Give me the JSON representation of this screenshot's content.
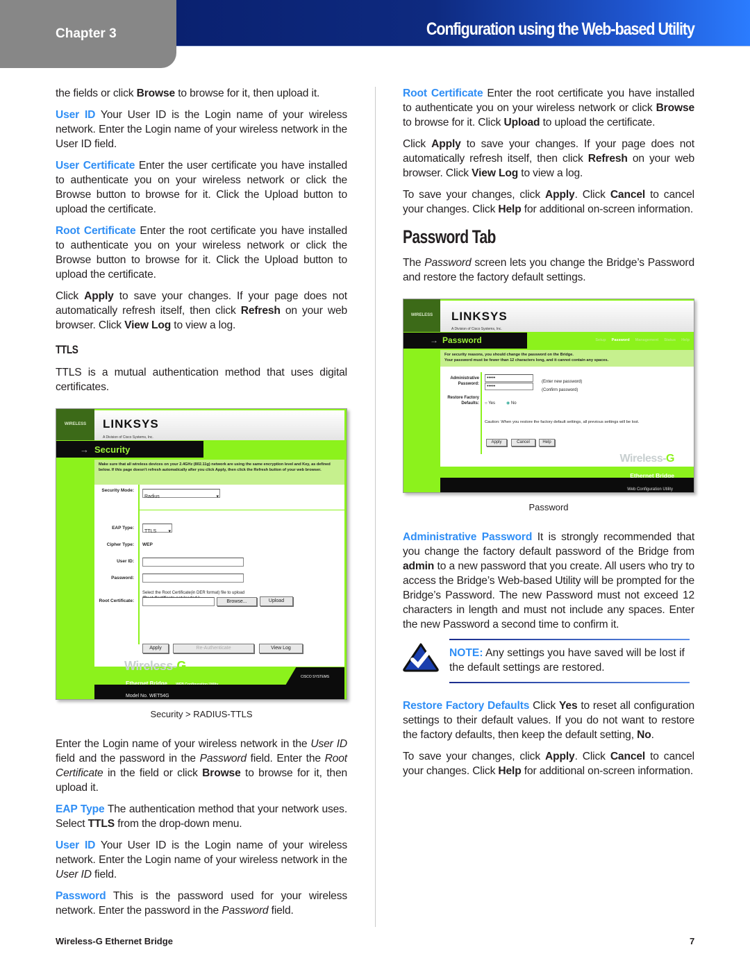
{
  "header": {
    "chapter": "Chapter 3",
    "title": "Configuration using the Web-based Utility"
  },
  "footer": {
    "product": "Wireless-G Ethernet Bridge",
    "page": "7"
  },
  "colors": {
    "accent": "#2f8ef5",
    "header_blue": "#0a2170",
    "linksys_green": "#8cf21c"
  },
  "left": {
    "top": [
      {
        "type": "p",
        "segs": [
          "the fields or click ",
          {
            "t": "Browse",
            "s": "b"
          },
          " to browse for it, then upload it."
        ]
      },
      {
        "type": "p",
        "segs": [
          {
            "t": "User ID",
            "s": "term"
          },
          "  Your User ID is the Login name of your wireless network. Enter the Login name of your wireless network in the User ID field."
        ]
      },
      {
        "type": "p",
        "segs": [
          {
            "t": "User Certificate",
            "s": "term"
          },
          "  Enter the user certificate you have installed to authenticate you on your wireless network or click the Browse button to browse for it. Click the Upload button to upload the certificate."
        ]
      },
      {
        "type": "p",
        "segs": [
          {
            "t": "Root Certificate",
            "s": "term"
          },
          "  Enter the root certificate you have installed to authenticate you on your wireless network or click the Browse button to browse for it. Click the Upload button to upload the certificate."
        ]
      },
      {
        "type": "p",
        "segs": [
          "Click ",
          {
            "t": "Apply",
            "s": "b"
          },
          " to save your changes. If your page does not automatically refresh itself, then click ",
          {
            "t": "Refresh",
            "s": "b"
          },
          " on your web browser. Click ",
          {
            "t": "View Log",
            "s": "b"
          },
          " to view a log."
        ]
      },
      {
        "type": "h3",
        "segs": [
          "TTLS"
        ]
      },
      {
        "type": "p",
        "segs": [
          "TTLS is a mutual authentication method that uses digital certificates."
        ]
      }
    ],
    "figure": {
      "caption": "Security > RADIUS-TTLS",
      "wireless": "WIRELESS",
      "logo": "LINKSYS",
      "logo_sub": "A Division of Cisco Systems, Inc.",
      "page": "Security",
      "info": "Make sure that all wireless devices on your 2.4GHz (802.11g) network are using the same encryption level and Key, as defined below. If this page doesn't refresh automatically after you click Apply, then click the Refresh button of your web browser.",
      "security_mode_label": "Security Mode:",
      "security_mode_value": "Radius",
      "eap_label": "EAP Type:",
      "eap_value": "TTLS",
      "cipher_label": "Cipher Type:",
      "cipher_value": "WEP",
      "userid_label": "User ID:",
      "password_label": "Password:",
      "root_hint": "Select the Root Certificate(in DER format) file to upload",
      "root_status": "(Root Certificate not loaded.)",
      "root_label": "Root Certificate:",
      "browse": "Browse...",
      "upload": "Upload",
      "apply": "Apply",
      "reauth": "Re-Authenticate",
      "viewlog": "View Log",
      "brand": "Wireless-",
      "brand_g": "G",
      "band": "Ethernet Bridge",
      "band_sub": "WEB Configuration Utility",
      "model": "Model No. WET54G",
      "cisco": "CISCO SYSTEMS"
    },
    "bottom": [
      {
        "type": "p",
        "segs": [
          "Enter the Login name of your wireless network in the ",
          {
            "t": "User ID",
            "s": "i"
          },
          " field and the password in the ",
          {
            "t": "Password",
            "s": "i"
          },
          " field. Enter the ",
          {
            "t": "Root Certificate",
            "s": "i"
          },
          " in the field or click ",
          {
            "t": "Browse",
            "s": "b"
          },
          " to browse for it, then upload it."
        ]
      },
      {
        "type": "p",
        "segs": [
          {
            "t": "EAP Type",
            "s": "term"
          },
          "  The authentication method that your network uses. Select ",
          {
            "t": "TTLS",
            "s": "b"
          },
          " from the drop-down menu."
        ]
      },
      {
        "type": "p",
        "segs": [
          {
            "t": "User ID",
            "s": "term"
          },
          "  Your User ID is the Login name of your wireless network. Enter the Login name of your wireless network in the ",
          {
            "t": "User ID",
            "s": "i"
          },
          " field."
        ]
      },
      {
        "type": "p",
        "segs": [
          {
            "t": "Password",
            "s": "term"
          },
          "  This is the password used for your wireless network. Enter the password in the ",
          {
            "t": "Password",
            "s": "i"
          },
          " field."
        ]
      }
    ]
  },
  "right": {
    "top": [
      {
        "type": "p",
        "segs": [
          {
            "t": "Root Certificate",
            "s": "term"
          },
          "  Enter the root certificate you have installed to authenticate you on your wireless network or click ",
          {
            "t": "Browse",
            "s": "b"
          },
          " to browse for it. Click ",
          {
            "t": "Upload",
            "s": "b"
          },
          " to upload the certificate."
        ]
      },
      {
        "type": "p",
        "segs": [
          "Click ",
          {
            "t": "Apply",
            "s": "b"
          },
          " to save your changes. If your page does not automatically refresh itself, then click ",
          {
            "t": "Refresh",
            "s": "b"
          },
          " on your web browser. Click ",
          {
            "t": "View Log",
            "s": "b"
          },
          " to view a log."
        ]
      },
      {
        "type": "p",
        "segs": [
          "To save your changes, click ",
          {
            "t": "Apply",
            "s": "b"
          },
          ". Click ",
          {
            "t": "Cancel",
            "s": "b"
          },
          " to cancel your changes. Click ",
          {
            "t": "Help",
            "s": "b"
          },
          " for additional on-screen information."
        ]
      },
      {
        "type": "h2",
        "segs": [
          "Password Tab"
        ]
      },
      {
        "type": "p",
        "segs": [
          "The ",
          {
            "t": "Password",
            "s": "i"
          },
          " screen lets you change the Bridge’s Password and restore the factory default settings."
        ]
      }
    ],
    "figure": {
      "caption": "Password",
      "wireless": "WIRELESS",
      "logo": "LINKSYS",
      "logo_sub": "A Division of Cisco Systems, Inc.",
      "page": "Password",
      "tabs": [
        "Setup",
        "Password",
        "Management",
        "Status",
        "Help"
      ],
      "info1": "For security reasons, you should change the password on the Bridge.",
      "info2": "Your password must be fewer than 12 characters long, and it cannot contain any spaces.",
      "admin_label": "Administrative Password:",
      "pw1": "•••••",
      "pw2": "•••••",
      "hint1": "(Enter new password)",
      "hint2": "(Confirm password)",
      "restore_label": "Restore Factory Defaults:",
      "yes": "Yes",
      "no": "No",
      "restore_selected": "No",
      "caution": "Caution: When you restore the factory default settings, all previous settings will be lost.",
      "apply": "Apply",
      "cancel": "Cancel",
      "help": "Help",
      "brand": "Wireless-",
      "brand_g": "G",
      "band": "Ethernet Bridge",
      "utility": "Web Configuration Utility"
    },
    "middle": [
      {
        "type": "p",
        "segs": [
          {
            "t": "Administrative Password",
            "s": "term"
          },
          "  It is strongly recommended that you change the factory default password of the Bridge from ",
          {
            "t": "admin",
            "s": "b"
          },
          " to a new password that you create. All users who try to access the Bridge’s Web-based Utility will be prompted for the Bridge’s Password. The new Password must not exceed 12 characters in length and must not include any spaces. Enter the new Password a second time to confirm it."
        ]
      }
    ],
    "note": {
      "icon": "checkmark-icon",
      "label": "NOTE:",
      "text": " Any settings you have saved will be lost if the default settings are restored."
    },
    "bottom": [
      {
        "type": "p",
        "segs": [
          {
            "t": "Restore Factory Defaults",
            "s": "term"
          },
          "  Click ",
          {
            "t": "Yes",
            "s": "b"
          },
          " to reset all configuration settings to their default values. If you do not want to restore the factory defaults, then keep the default setting, ",
          {
            "t": "No",
            "s": "b"
          },
          "."
        ]
      },
      {
        "type": "p",
        "segs": [
          "To save your changes, click ",
          {
            "t": "Apply",
            "s": "b"
          },
          ". Click ",
          {
            "t": "Cancel",
            "s": "b"
          },
          " to cancel your changes. Click ",
          {
            "t": "Help",
            "s": "b"
          },
          " for additional on-screen information."
        ]
      }
    ]
  }
}
